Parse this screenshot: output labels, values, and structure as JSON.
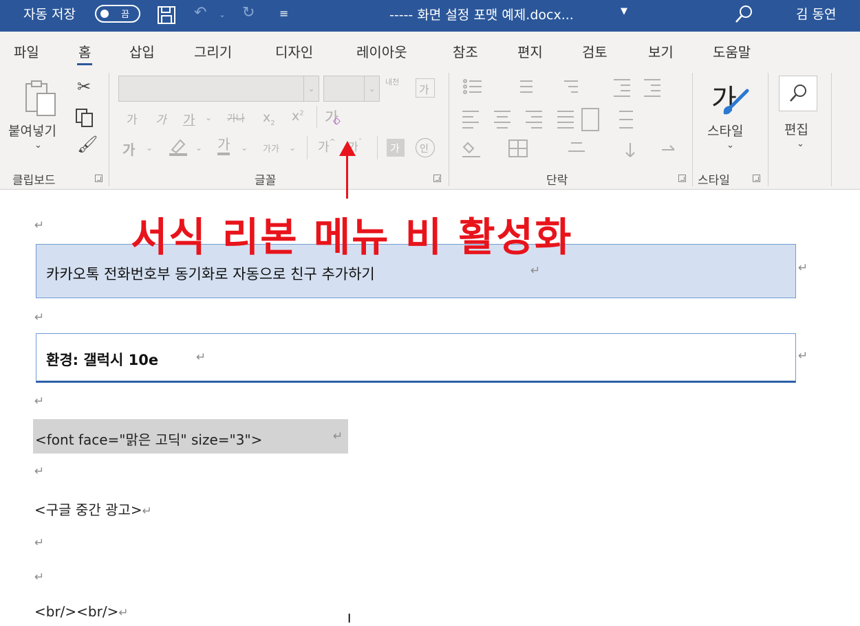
{
  "titlebar": {
    "autosave_label": "자동 저장",
    "autosave_state": "끔",
    "document_title": "----- 화면 설정 포맷 예제.docx...",
    "user_name": "김 동연",
    "icons": [
      "save-icon",
      "undo-icon",
      "redo-icon",
      "customize-icon",
      "search-icon"
    ]
  },
  "tabs": [
    "파일",
    "홈",
    "삽입",
    "그리기",
    "디자인",
    "레이아웃",
    "참조",
    "편지",
    "검토",
    "보기",
    "도움말"
  ],
  "active_tab": "홈",
  "ribbon": {
    "clipboard": {
      "paste_label": "붙여넣기",
      "group_label": "클립보드"
    },
    "font": {
      "group_label": "글꼴",
      "grow_label": "내천",
      "bold": "가",
      "italic": "가",
      "underline": "가",
      "strike": "가나",
      "subscript": "x",
      "subscript_mark": "2",
      "superscript": "x",
      "superscript_mark": "2",
      "clear_format": "가",
      "effects": "가",
      "highlight": "가",
      "font_color": "가",
      "case": "가가",
      "size_up": "가",
      "size_down": "가",
      "char_border": "가",
      "enclose": "인",
      "phonetic": "가"
    },
    "paragraph": {
      "group_label": "단락"
    },
    "styles": {
      "button_label": "스타일",
      "group_label": "스타일",
      "glyph": "가"
    },
    "editing": {
      "button_label": "편집"
    }
  },
  "annotation": {
    "text": "서식 리본 메뉴 비 활성화",
    "color": "#e8141c"
  },
  "document": {
    "heading1": "카카오톡 전화번호부 동기화로 자동으로 친구 추가하기",
    "heading2": "환경: 갤럭시 10e",
    "font_tag": "<font face=\"맑은 고딕\" size=\"3\">",
    "ad_tag": "<구글 중간 광고>",
    "br_tag": "<br/><br/>",
    "para_mark": "↵"
  },
  "colors": {
    "titlebar": "#2b579a",
    "ribbon": "#f3f2f1",
    "heading_fill": "#d4e0f1"
  }
}
